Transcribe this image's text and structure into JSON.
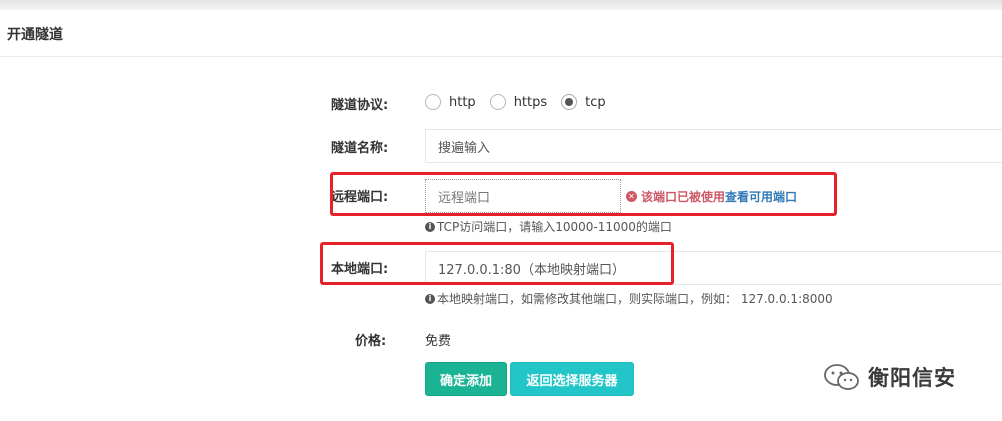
{
  "panel": {
    "title": "开通隧道"
  },
  "form": {
    "protocol": {
      "label": "隧道协议:",
      "options": [
        {
          "label": "http",
          "checked": false
        },
        {
          "label": "https",
          "checked": false
        },
        {
          "label": "tcp",
          "checked": true
        }
      ]
    },
    "tunnel_name": {
      "label": "隧道名称:",
      "value": "搜遍输入"
    },
    "remote_port": {
      "label": "远程端口:",
      "placeholder": "远程端口",
      "error_text": "该端口已被使用",
      "error_link": "查看可用端口",
      "help": "TCP访问端口，请输入10000-11000的端口"
    },
    "local_port": {
      "label": "本地端口:",
      "value": "127.0.0.1:80（本地映射端口）",
      "help": "本地映射端口，如需修改其他端口，则实际端口，例如： 127.0.0.1:8000"
    },
    "price": {
      "label": "价格:",
      "value": "免费"
    }
  },
  "buttons": {
    "confirm_label": "确定添加",
    "back_label": "返回选择服务器"
  },
  "watermark": {
    "text": "衡阳信安"
  },
  "colors": {
    "primary": "#1ab394",
    "info": "#23c6c8",
    "danger": "#cc5965",
    "link": "#337ab7",
    "highlight": "#e8202a"
  }
}
